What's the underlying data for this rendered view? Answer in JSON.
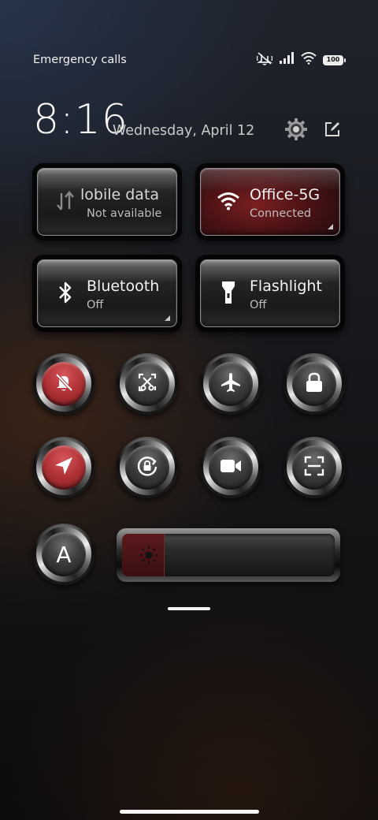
{
  "status_bar": {
    "carrier_text": "Emergency calls o",
    "battery": "100",
    "icons": [
      "mute-vibrate-icon",
      "signal-icon",
      "wifi-icon",
      "battery-icon"
    ]
  },
  "header": {
    "time": "8:16",
    "date": "Wednesday, April 12",
    "settings_icon": "gear-icon",
    "edit_icon": "edit-icon"
  },
  "tiles": {
    "mobile_data": {
      "title": "lobile data",
      "subtitle": "Not available",
      "icon": "mobile-data-arrows-icon",
      "active": false
    },
    "wifi": {
      "title": "Office-5G",
      "subtitle": "Connected",
      "icon": "wifi-icon",
      "active": true
    },
    "bluetooth": {
      "title": "Bluetooth",
      "subtitle": "Off",
      "icon": "bluetooth-icon",
      "active": false
    },
    "flashlight": {
      "title": "Flashlight",
      "subtitle": "Off",
      "icon": "flashlight-icon",
      "active": false
    }
  },
  "toggles_row1": [
    {
      "icon": "bell-off-icon",
      "active": true
    },
    {
      "icon": "screenshot-icon",
      "active": false
    },
    {
      "icon": "airplane-icon",
      "active": false
    },
    {
      "icon": "lock-icon",
      "active": false
    }
  ],
  "toggles_row2": [
    {
      "icon": "location-icon",
      "active": true
    },
    {
      "icon": "rotation-lock-icon",
      "active": false
    },
    {
      "icon": "video-camera-icon",
      "active": false
    },
    {
      "icon": "scan-icon",
      "active": false
    }
  ],
  "auto_brightness": {
    "label": "A",
    "icon": "auto-brightness-icon"
  },
  "brightness": {
    "level_percent": 20,
    "icon": "sun-icon"
  },
  "colors": {
    "accent_red": "#b23438",
    "tile_red": "#4a1214"
  }
}
